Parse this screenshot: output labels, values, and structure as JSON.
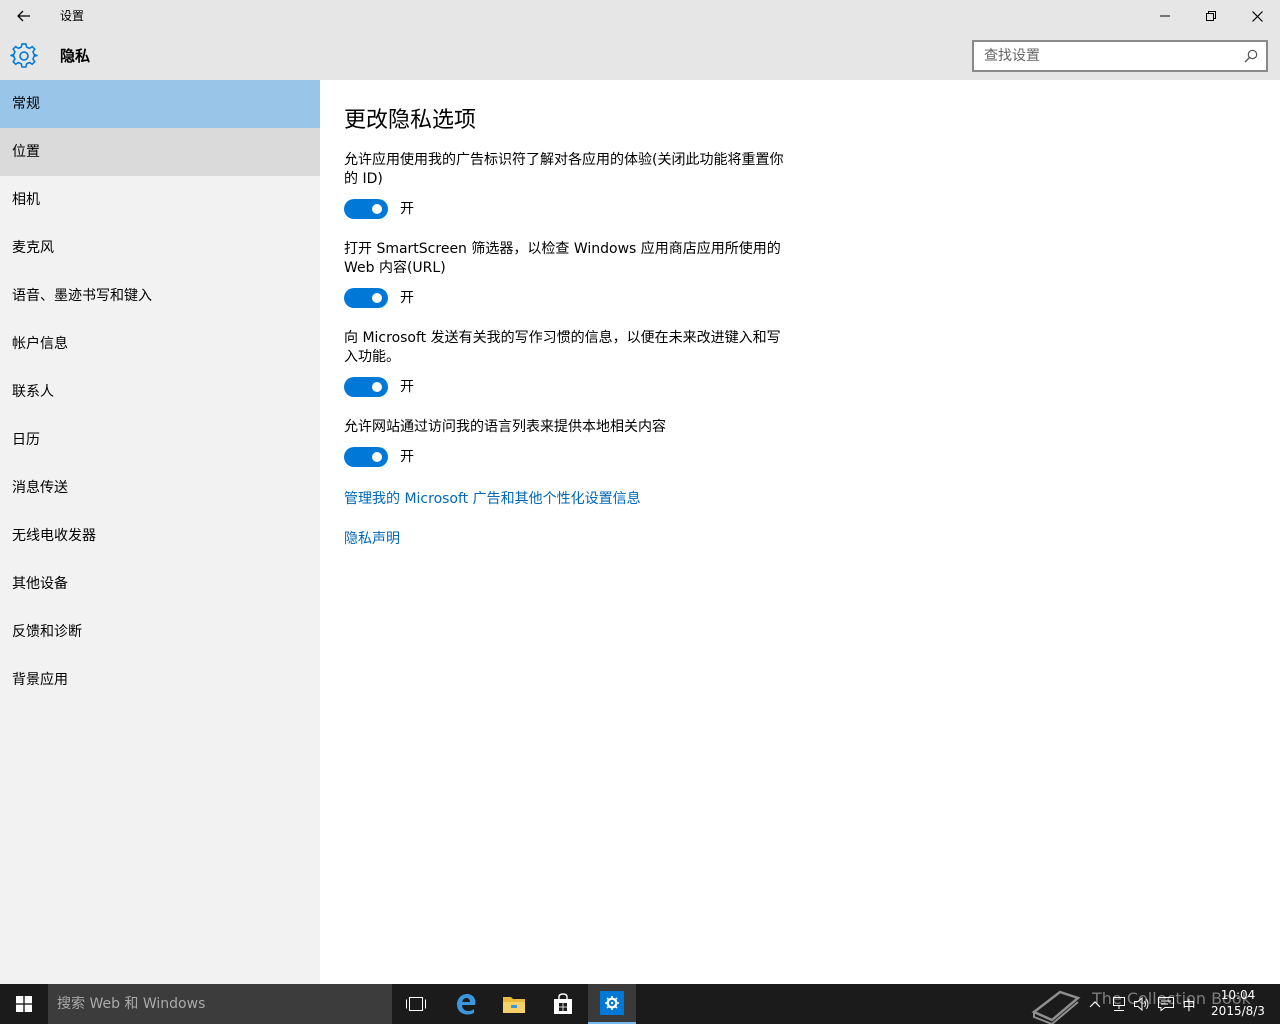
{
  "window": {
    "title": "设置"
  },
  "header": {
    "section": "隐私",
    "search_placeholder": "查找设置"
  },
  "sidebar": {
    "items": [
      {
        "label": "常规"
      },
      {
        "label": "位置"
      },
      {
        "label": "相机"
      },
      {
        "label": "麦克风"
      },
      {
        "label": "语音、墨迹书写和键入"
      },
      {
        "label": "帐户信息"
      },
      {
        "label": "联系人"
      },
      {
        "label": "日历"
      },
      {
        "label": "消息传送"
      },
      {
        "label": "无线电收发器"
      },
      {
        "label": "其他设备"
      },
      {
        "label": "反馈和诊断"
      },
      {
        "label": "背景应用"
      }
    ],
    "selected_index": 0
  },
  "main": {
    "title": "更改隐私选项",
    "settings": [
      {
        "desc": "允许应用使用我的广告标识符了解对各应用的体验(关闭此功能将重置你的 ID)",
        "state": "开",
        "on": true
      },
      {
        "desc": "打开 SmartScreen 筛选器，以检查 Windows 应用商店应用所使用的 Web 内容(URL)",
        "state": "开",
        "on": true
      },
      {
        "desc": "向 Microsoft 发送有关我的写作习惯的信息，以便在未来改进键入和写入功能。",
        "state": "开",
        "on": true
      },
      {
        "desc": "允许网站通过访问我的语言列表来提供本地相关内容",
        "state": "开",
        "on": true
      }
    ],
    "links": {
      "manage_ads": "管理我的 Microsoft 广告和其他个性化设置信息",
      "privacy_statement": "隐私声明"
    }
  },
  "taskbar": {
    "search_placeholder": "搜索 Web 和 Windows",
    "apps": [
      "task-view",
      "edge",
      "file-explorer",
      "store",
      "settings"
    ],
    "ime": "中",
    "time": "10:04",
    "date": "2015/8/3",
    "watermark": "The Collection Book"
  },
  "colors": {
    "accent": "#0078d7",
    "link": "#0067b8",
    "selected_nav": "#99c5e9",
    "hover_nav": "#dadada",
    "taskbar": "#1b1b1b"
  }
}
